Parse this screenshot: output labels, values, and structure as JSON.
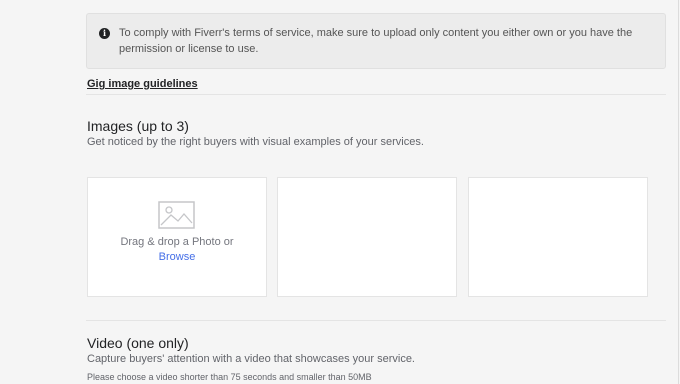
{
  "notice": {
    "text": "To comply with Fiverr's terms of service, make sure to upload only content you either own or you have the permission or license to use."
  },
  "guidelines_link": "Gig image guidelines",
  "images_section": {
    "title": "Images (up to 3)",
    "subtitle": "Get noticed by the right buyers with visual examples of your services.",
    "slot1": {
      "drop_text": "Drag & drop a Photo or",
      "browse_label": "Browse"
    }
  },
  "video_section": {
    "title": "Video (one only)",
    "subtitle": "Capture buyers' attention with a video that showcases your service.",
    "note": "Please choose a video shorter than 75 seconds and smaller than 50MB"
  },
  "colors": {
    "background": "#f5f5f5",
    "link": "#446ee7",
    "text_dark": "#222325"
  }
}
